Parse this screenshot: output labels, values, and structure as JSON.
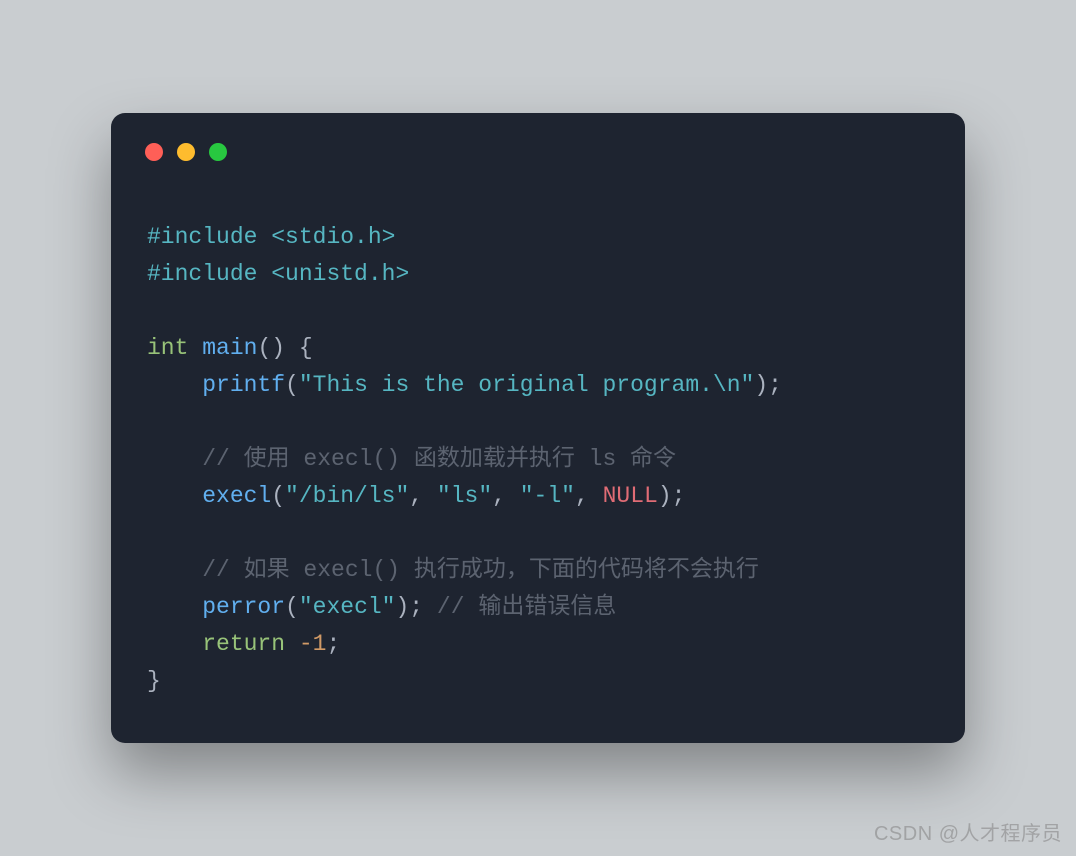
{
  "code": {
    "line1": {
      "preproc": "#include",
      "sp": " ",
      "header": "<stdio.h>"
    },
    "line2": {
      "preproc": "#include",
      "sp": " ",
      "header": "<unistd.h>"
    },
    "line3": "",
    "line4": {
      "type": "int",
      "sp1": " ",
      "fn": "main",
      "open": "(",
      "close": ")",
      "sp2": " ",
      "brace": "{"
    },
    "line5": {
      "indent": "    ",
      "fn": "printf",
      "open": "(",
      "str": "\"This is the original program.\\n\"",
      "close": ")",
      "semi": ";"
    },
    "line6": "",
    "line7": {
      "indent": "    ",
      "comment": "// 使用 execl() 函数加载并执行 ls 命令"
    },
    "line8": {
      "indent": "    ",
      "fn": "execl",
      "open": "(",
      "arg1": "\"/bin/ls\"",
      "c1": ",",
      "sp1": " ",
      "arg2": "\"ls\"",
      "c2": ",",
      "sp2": " ",
      "arg3": "\"-l\"",
      "c3": ",",
      "sp3": " ",
      "nullkw": "NULL",
      "close": ")",
      "semi": ";"
    },
    "line9": "",
    "line10": {
      "indent": "    ",
      "comment": "// 如果 execl() 执行成功，下面的代码将不会执行"
    },
    "line11": {
      "indent": "    ",
      "fn": "perror",
      "open": "(",
      "arg": "\"execl\"",
      "close": ")",
      "semi": ";",
      "sp": " ",
      "comment": "// 输出错误信息"
    },
    "line12": {
      "indent": "    ",
      "kw": "return",
      "sp": " ",
      "neg": "-",
      "num": "1",
      "semi": ";"
    },
    "line13": {
      "brace": "}"
    }
  },
  "watermark": "CSDN @人才程序员"
}
